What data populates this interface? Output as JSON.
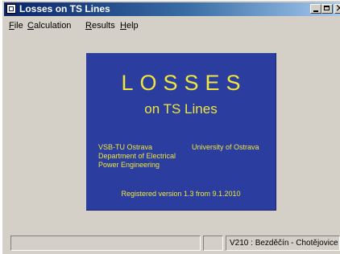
{
  "window": {
    "title": "Losses on TS Lines"
  },
  "menu": {
    "items": [
      {
        "underline": "F",
        "rest": "ile"
      },
      {
        "underline": "C",
        "rest": "alculation"
      },
      {
        "underline": "R",
        "rest": "esults"
      },
      {
        "underline": "H",
        "rest": "elp"
      }
    ]
  },
  "splash": {
    "title": "LOSSES",
    "subtitle": "on TS Lines",
    "org_line1": "VSB-TU Ostrava",
    "org_line2": "Department of Electrical",
    "org_line3": "Power Engineering",
    "university": "University of Ostrava",
    "version": "Registered version 1.3 from 9.1.2010",
    "background_color": "#2b3ea0",
    "text_color": "#f0e63c"
  },
  "statusbar": {
    "panel1": "",
    "panel2": "",
    "panel3": "V210 : Bezděčín - Chotějovice"
  }
}
